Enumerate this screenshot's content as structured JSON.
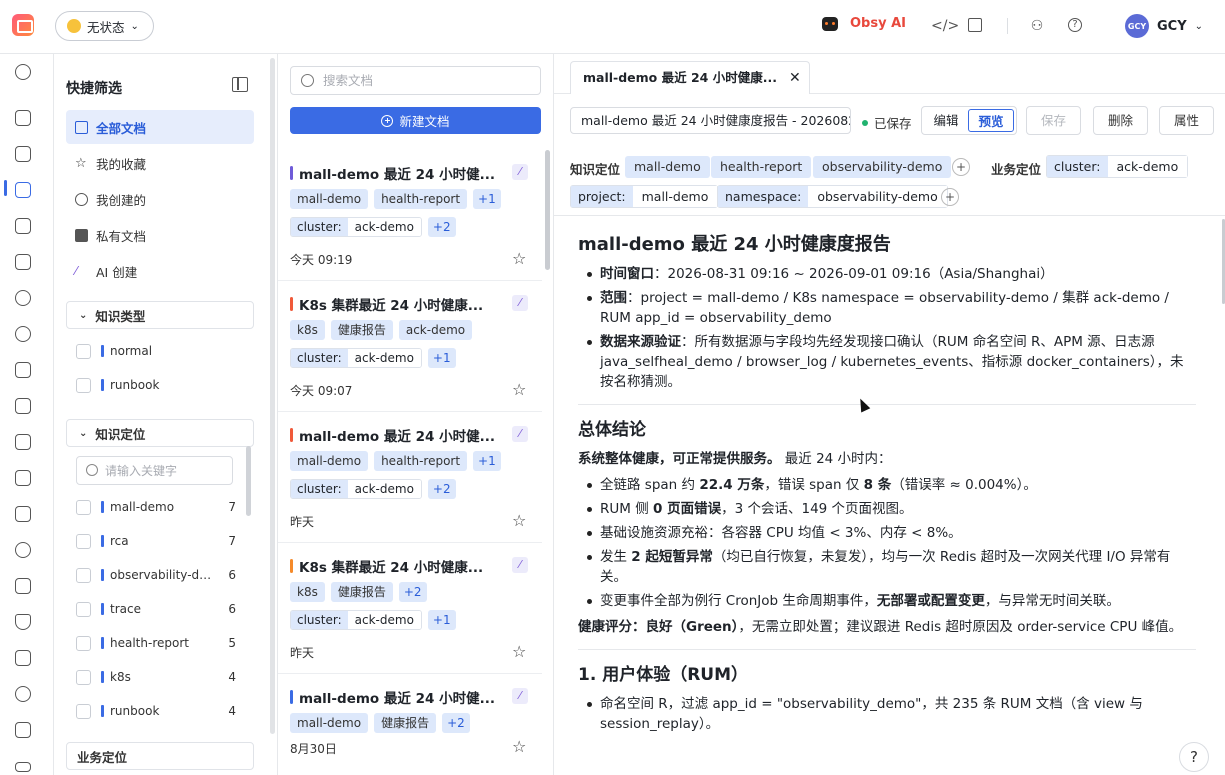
{
  "topbar": {
    "status_label": "无状态",
    "ai_label": "Obsy AI",
    "user_initials": "GCY",
    "user_name": "GCY"
  },
  "filter": {
    "title": "快捷筛选",
    "items": [
      {
        "label": "全部文档",
        "icon": "grid-icon"
      },
      {
        "label": "我的收藏",
        "icon": "star-icon"
      },
      {
        "label": "我创建的",
        "icon": "user-icon"
      },
      {
        "label": "私有文档",
        "icon": "lock-icon"
      },
      {
        "label": "AI 创建",
        "icon": "sparkle-icon"
      }
    ],
    "type_section": "知识类型",
    "types": [
      {
        "label": "normal"
      },
      {
        "label": "runbook"
      }
    ],
    "location_section": "知识定位",
    "keyword_placeholder": "请输入关键字",
    "locations": [
      {
        "label": "mall-demo",
        "count": "7"
      },
      {
        "label": "rca",
        "count": "7"
      },
      {
        "label": "observability-demo",
        "count": "6"
      },
      {
        "label": "trace",
        "count": "6"
      },
      {
        "label": "health-report",
        "count": "5"
      },
      {
        "label": "k8s",
        "count": "4"
      },
      {
        "label": "runbook",
        "count": "4"
      }
    ],
    "business_section": "业务定位"
  },
  "doclist": {
    "search_placeholder": "搜索文档",
    "new_doc_label": "新建文档",
    "cards": [
      {
        "title": "mall-demo 最近 24 小时健...",
        "bar_color": "#6f5bd8",
        "tags": [
          "mall-demo",
          "health-report",
          "+1"
        ],
        "kv": {
          "k": "cluster:",
          "v": "ack-demo",
          "more": "+2"
        },
        "time": "今天 09:19"
      },
      {
        "title": "K8s 集群最近 24 小时健康...",
        "bar_color": "#f05a3a",
        "tags": [
          "k8s",
          "健康报告",
          "ack-demo"
        ],
        "kv": {
          "k": "cluster:",
          "v": "ack-demo",
          "more": "+1"
        },
        "time": "今天 09:07"
      },
      {
        "title": "mall-demo 最近 24 小时健...",
        "bar_color": "#f05a3a",
        "tags": [
          "mall-demo",
          "health-report",
          "+1"
        ],
        "kv": {
          "k": "cluster:",
          "v": "ack-demo",
          "more": "+2"
        },
        "time": "昨天"
      },
      {
        "title": "K8s 集群最近 24 小时健康...",
        "bar_color": "#f58a2a",
        "tags": [
          "k8s",
          "健康报告",
          "+2"
        ],
        "kv": {
          "k": "cluster:",
          "v": "ack-demo",
          "more": "+1"
        },
        "time": "昨天"
      },
      {
        "title": "mall-demo 最近 24 小时健...",
        "bar_color": "#3a6be4",
        "tags": [
          "mall-demo",
          "健康报告",
          "+2"
        ],
        "kv": null,
        "time": "8月30日"
      }
    ]
  },
  "main": {
    "tab_label": "mall-demo 最近 24 小时健康...",
    "title_input": "mall-demo 最近 24 小时健康度报告 - 2026082",
    "saved_label": "已保存",
    "mode_edit": "编辑",
    "mode_preview": "预览",
    "save_btn": "保存",
    "delete_btn": "删除",
    "props_btn": "属性",
    "knowledge_label": "知识定位",
    "knowledge_tags": [
      "mall-demo",
      "health-report",
      "observability-demo"
    ],
    "business_label": "业务定位",
    "business_kv": [
      {
        "k": "cluster:",
        "v": "ack-demo"
      },
      {
        "k": "project:",
        "v": "mall-demo"
      },
      {
        "k": "namespace:",
        "v": "observability-demo"
      }
    ],
    "content": {
      "h1": "mall-demo 最近 24 小时健康度报告",
      "meta1_k": "时间窗口",
      "meta1_v": "：2026-08-31 09:16 ~ 2026-09-01 09:16（Asia/Shanghai）",
      "meta2_k": "范围",
      "meta2_v": "：project = mall-demo / K8s namespace = observability-demo / 集群 ack-demo / RUM app_id = observability_demo",
      "meta3_k": "数据来源验证",
      "meta3_v": "：所有数据源与字段均先经发现接口确认（RUM 命名空间 R、APM 源、日志源 java_selfheal_demo / browser_log / kubernetes_events、指标源 docker_containers），未按名称猜测。",
      "h2a": "总体结论",
      "summary_b": "系统整体健康，可正常提供服务。",
      "summary_rest": " 最近 24 小时内：",
      "b1_a": "全链路 span 约 ",
      "b1_b": "22.4 万条",
      "b1_c": "，错误 span 仅 ",
      "b1_d": "8 条",
      "b1_e": "（错误率 ≈ 0.004%）。",
      "b2_a": "RUM 侧 ",
      "b2_b": "0 页面错误",
      "b2_c": "，3 个会话、149 个页面视图。",
      "b3": "基础设施资源充裕：各容器 CPU 均值 < 3%、内存 < 8%。",
      "b4_a": "发生 ",
      "b4_b": "2 起短暂异常",
      "b4_c": "（均已自行恢复，未复发），均与一次 Redis 超时及一次网关代理 I/O 异常有关。",
      "b5_a": "变更事件全部为例行 CronJob 生命周期事件，",
      "b5_b": "无部署或配置变更",
      "b5_c": "，与异常无时间关联。",
      "score_b": "健康评分：良好（Green）",
      "score_rest": "，无需立即处置；建议跟进 Redis 超时原因及 order-service CPU 峰值。",
      "h2b": "1. 用户体验（RUM）",
      "rum1": "命名空间 R，过滤 app_id = \"observability_demo\"，共 235 条 RUM 文档（含 view 与 session_replay）。"
    }
  }
}
